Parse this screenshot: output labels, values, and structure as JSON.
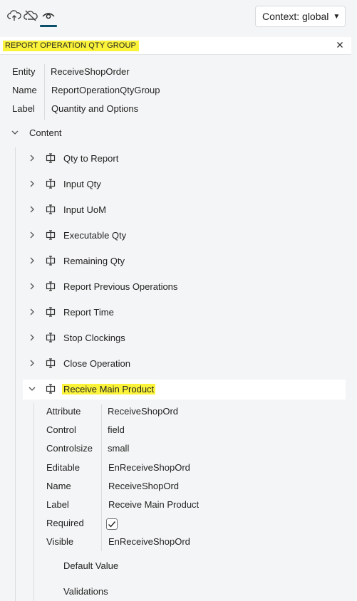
{
  "toolbar": {
    "icons": [
      "cloud-upload-icon",
      "cloud-off-icon",
      "eye-icon"
    ],
    "context_label": "Context: global"
  },
  "search": {
    "value": "REPORT OPERATION QTY GROUP"
  },
  "properties": [
    {
      "label": "Entity",
      "value": "ReceiveShopOrder"
    },
    {
      "label": "Name",
      "value": "ReportOperationQtyGroup"
    },
    {
      "label": "Label",
      "value": "Quantity and Options"
    }
  ],
  "content": {
    "label": "Content",
    "items": [
      {
        "label": "Qty to Report"
      },
      {
        "label": "Input Qty"
      },
      {
        "label": "Input UoM"
      },
      {
        "label": "Executable Qty"
      },
      {
        "label": "Remaining Qty"
      },
      {
        "label": "Report Previous Operations"
      },
      {
        "label": "Report Time"
      },
      {
        "label": "Stop Clockings"
      },
      {
        "label": "Close Operation"
      },
      {
        "label": "Receive Main Product"
      }
    ]
  },
  "selected_item": {
    "attributes": [
      {
        "label": "Attribute",
        "value": "ReceiveShopOrd"
      },
      {
        "label": "Control",
        "value": "field"
      },
      {
        "label": "Controlsize",
        "value": "small"
      },
      {
        "label": "Editable",
        "value": "EnReceiveShopOrd"
      },
      {
        "label": "Name",
        "value": "ReceiveShopOrd"
      },
      {
        "label": "Label",
        "value": "Receive Main Product"
      },
      {
        "label": "Required",
        "value": "",
        "checked": true
      },
      {
        "label": "Visible",
        "value": "EnReceiveShopOrd"
      }
    ],
    "sections": [
      {
        "label": "Default Value"
      },
      {
        "label": "Validations"
      }
    ]
  },
  "colors": {
    "highlight": "#fbf33a",
    "accent": "#0b4f6c",
    "background": "#f4f5f6"
  }
}
